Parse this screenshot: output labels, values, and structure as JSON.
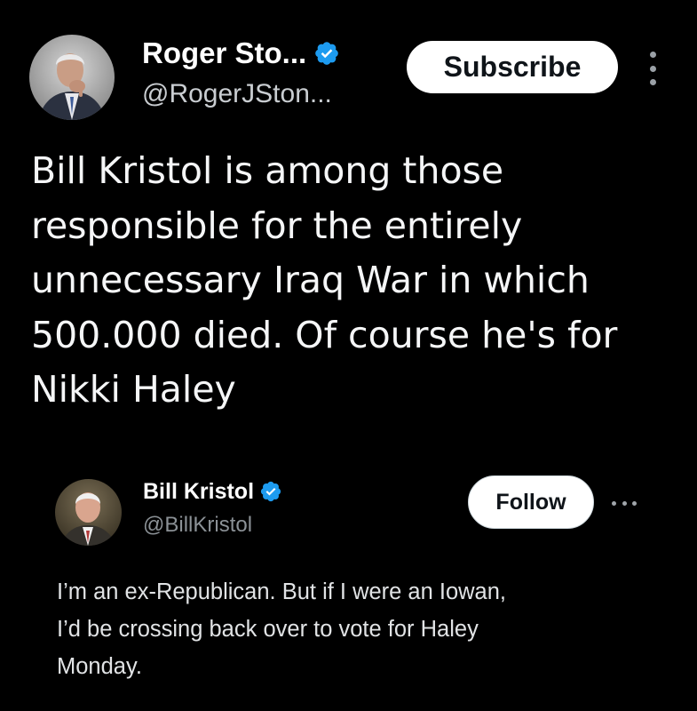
{
  "post": {
    "author": {
      "display_name": "Roger Sto...",
      "handle": "@RogerJSton...",
      "verified": true,
      "avatar_icon": "profile-photo"
    },
    "subscribe_label": "Subscribe",
    "more_icon": "more-vertical-icon",
    "text_lines": [
      "Bill Kristol is among those",
      "responsible for the entirely",
      "unnecessary Iraq War in which",
      "500.000 died. Of course he's for",
      "Nikki Haley"
    ]
  },
  "quoted_post": {
    "author": {
      "display_name": "Bill Kristol",
      "handle": "@BillKristol",
      "verified": true,
      "avatar_icon": "profile-photo"
    },
    "follow_label": "Follow",
    "more_icon": "more-horizontal-icon",
    "text_lines": [
      "I’m an ex-Republican. But if I were an Iowan,",
      "I’d be crossing back over to vote for Haley",
      "Monday."
    ]
  },
  "colors": {
    "background": "#000000",
    "verified_blue": "#1d9bf0",
    "button_bg": "#ffffff",
    "button_text": "#0f1419"
  }
}
